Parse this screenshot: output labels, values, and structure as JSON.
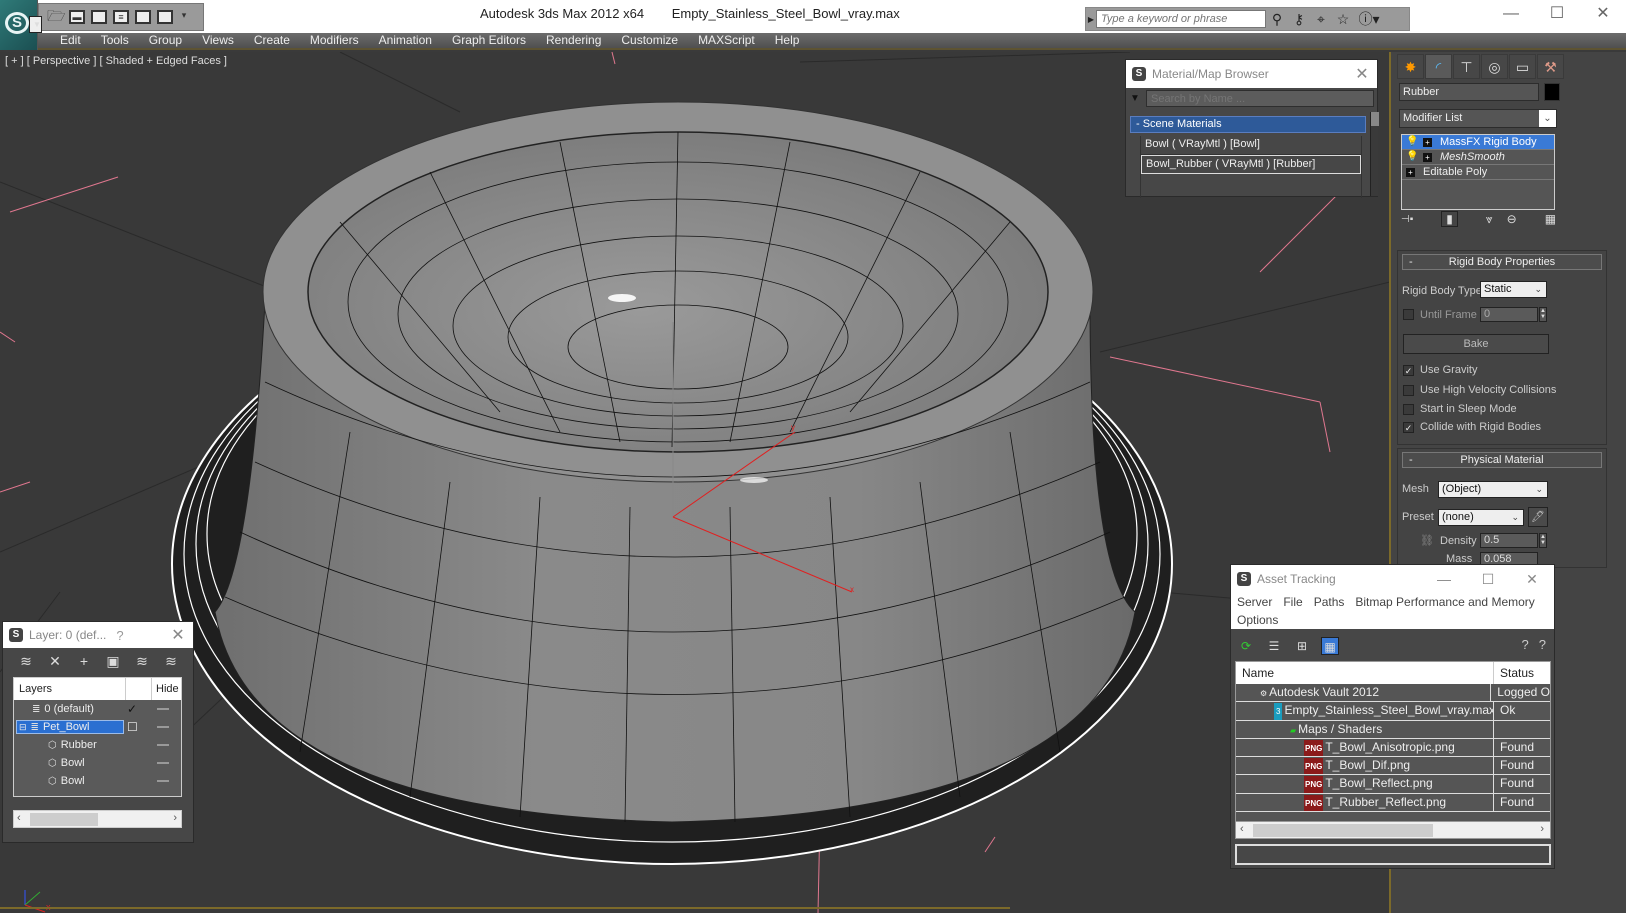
{
  "titlebar": {
    "app": "Autodesk 3ds Max  2012 x64",
    "file": "Empty_Stainless_Steel_Bowl_vray.max",
    "search_placeholder": "Type a keyword or phrase",
    "quick_access": [
      "open-icon",
      "save-icon",
      "new-icon",
      "hold-icon",
      "window-icon",
      "window2-icon",
      "more-icon"
    ],
    "info_icons": [
      "binoculars-icon",
      "key-icon",
      "satellite-icon",
      "star-icon",
      "help-icon"
    ],
    "window_buttons": {
      "minimize": "—",
      "maximize": "☐",
      "close": "✕"
    }
  },
  "menu": [
    "Edit",
    "Tools",
    "Group",
    "Views",
    "Create",
    "Modifiers",
    "Animation",
    "Graph Editors",
    "Rendering",
    "Customize",
    "MAXScript",
    "Help"
  ],
  "viewport": {
    "label": "[ + ] [ Perspective ] [ Shaded + Edged Faces ]",
    "gizmo_axes": [
      "x",
      "y",
      "z"
    ]
  },
  "material_browser": {
    "title": "Material/Map Browser",
    "search_placeholder": "Search by Name ...",
    "group": "- Scene Materials",
    "items": [
      "Bowl  ( VRayMtl )  [Bowl]",
      "Bowl_Rubber  ( VRayMtl )  [Rubber]"
    ]
  },
  "command_panel": {
    "tabs": [
      "create-tab",
      "modify-tab",
      "hierarchy-tab",
      "motion-tab",
      "display-tab",
      "utilities-tab"
    ],
    "object_name": "Rubber",
    "object_color": "#000000",
    "modifier_list": "Modifier List",
    "stack": [
      {
        "label": "MassFX Rigid Body",
        "bulb": true,
        "selected": true,
        "italic": false
      },
      {
        "label": "MeshSmooth",
        "bulb": true,
        "selected": false,
        "italic": true
      },
      {
        "label": "Editable Poly",
        "bulb": false,
        "selected": false,
        "italic": false
      }
    ],
    "rigid_body": {
      "title": "Rigid Body Properties",
      "type_label": "Rigid Body Type",
      "type_value": "Static",
      "until_frame_label": "Until Frame",
      "until_frame_value": "0",
      "until_frame_checked": false,
      "bake": "Bake",
      "options": [
        {
          "label": "Use Gravity",
          "checked": true
        },
        {
          "label": "Use High Velocity Collisions",
          "checked": false
        },
        {
          "label": "Start in Sleep Mode",
          "checked": false
        },
        {
          "label": "Collide with Rigid Bodies",
          "checked": true
        }
      ]
    },
    "physical_material": {
      "title": "Physical Material",
      "mesh_label": "Mesh",
      "mesh_value": "(Object)",
      "preset_label": "Preset",
      "preset_value": "(none)",
      "density_label": "Density",
      "density_value": "0.5",
      "mass_label": "Mass",
      "mass_value": "0.058"
    }
  },
  "layer_dialog": {
    "title": "Layer: 0 (def...",
    "help": "?",
    "col_layers": "Layers",
    "col_hide": "Hide",
    "rows": [
      {
        "name": "0 (default)",
        "type": "layer",
        "current": true,
        "indent": 1
      },
      {
        "name": "Pet_Bowl",
        "type": "layer",
        "selected": true,
        "indent": 0
      },
      {
        "name": "Rubber",
        "type": "object",
        "indent": 2
      },
      {
        "name": "Bowl",
        "type": "object",
        "indent": 2
      },
      {
        "name": "Bowl",
        "type": "object",
        "indent": 2
      }
    ]
  },
  "asset_tracking": {
    "title": "Asset Tracking",
    "menu": [
      "Server",
      "File",
      "Paths",
      "Bitmap Performance and Memory",
      "Options"
    ],
    "col_name": "Name",
    "col_status": "Status",
    "rows": [
      {
        "name": "Autodesk Vault 2012",
        "status": "Logged O",
        "icon": "vault-icon",
        "indent": 1
      },
      {
        "name": "Empty_Stainless_Steel_Bowl_vray.max",
        "status": "Ok",
        "icon": "max-file-icon",
        "indent": 2
      },
      {
        "name": "Maps / Shaders",
        "status": "",
        "icon": "maps-icon",
        "indent": 3
      },
      {
        "name": "T_Bowl_Anisotropic.png",
        "status": "Found",
        "icon": "png-icon",
        "indent": 4
      },
      {
        "name": "T_Bowl_Dif.png",
        "status": "Found",
        "icon": "png-icon",
        "indent": 4
      },
      {
        "name": "T_Bowl_Reflect.png",
        "status": "Found",
        "icon": "png-icon",
        "indent": 4
      },
      {
        "name": "T_Rubber_Reflect.png",
        "status": "Found",
        "icon": "png-icon",
        "indent": 4
      }
    ]
  }
}
